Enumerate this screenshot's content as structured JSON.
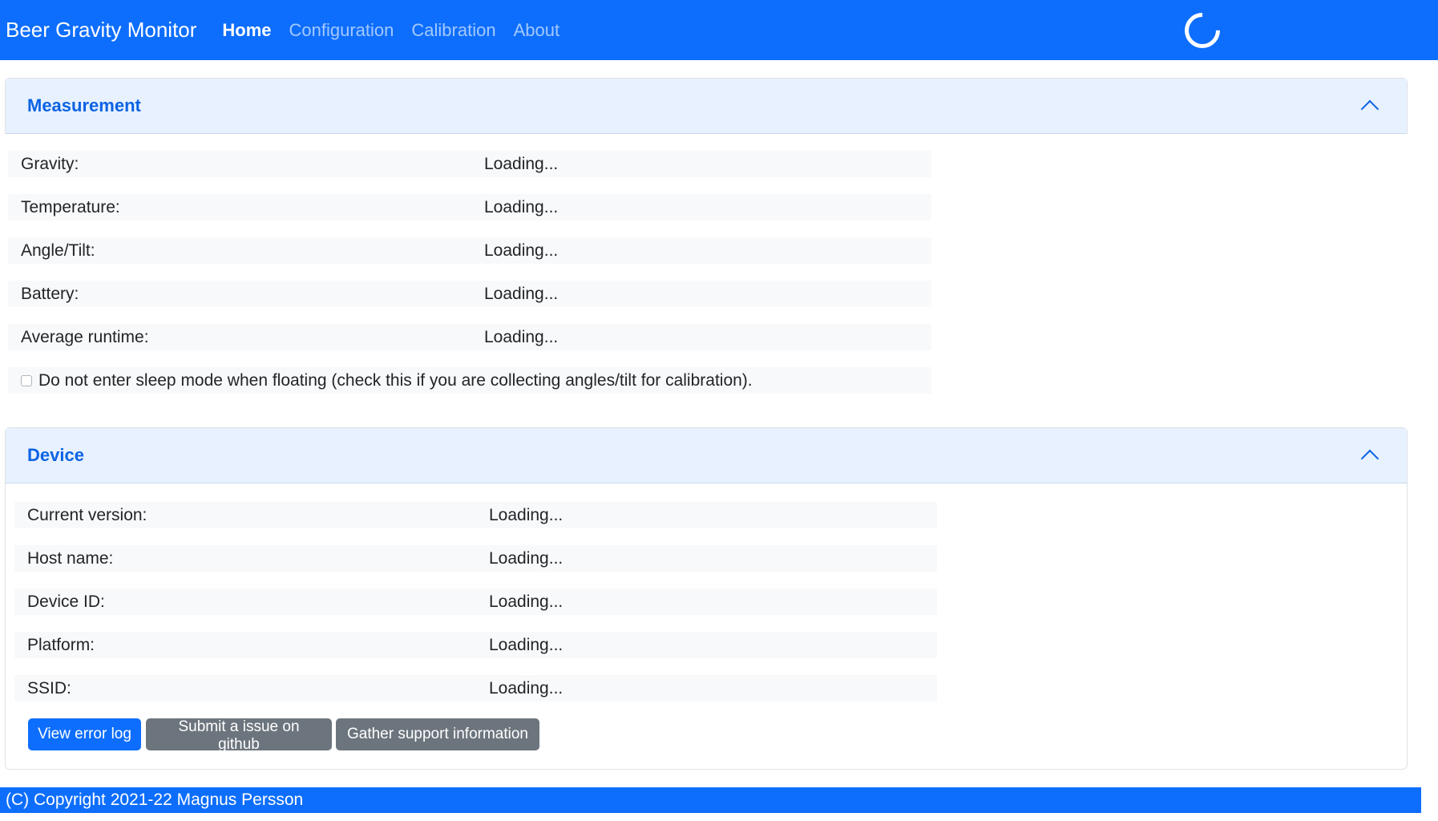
{
  "navbar": {
    "brand": "Beer Gravity Monitor",
    "links": [
      "Home",
      "Configuration",
      "Calibration",
      "About"
    ],
    "active": "Home"
  },
  "measurement": {
    "title": "Measurement",
    "rows": [
      {
        "label": "Gravity:",
        "value": "Loading..."
      },
      {
        "label": "Temperature:",
        "value": "Loading..."
      },
      {
        "label": "Angle/Tilt:",
        "value": "Loading..."
      },
      {
        "label": "Battery:",
        "value": "Loading..."
      },
      {
        "label": "Average runtime:",
        "value": "Loading..."
      }
    ],
    "sleep_checkbox": {
      "label": "Do not enter sleep mode when floating (check this if you are collecting angles/tilt for calibration).",
      "checked": false
    }
  },
  "device": {
    "title": "Device",
    "rows": [
      {
        "label": "Current version:",
        "value": "Loading..."
      },
      {
        "label": "Host name:",
        "value": "Loading..."
      },
      {
        "label": "Device ID:",
        "value": "Loading..."
      },
      {
        "label": "Platform:",
        "value": "Loading..."
      },
      {
        "label": "SSID:",
        "value": "Loading..."
      }
    ],
    "buttons": {
      "error_log": "View error log",
      "github": "Submit a issue on github",
      "support": "Gather support information"
    }
  },
  "footer": {
    "copyright": "(C) Copyright 2021-22 Magnus Persson"
  },
  "colors": {
    "primary": "#0d6efd",
    "secondary": "#6c757d",
    "header_bg": "#e7f1ff",
    "row_bg": "#f8f9fa"
  }
}
